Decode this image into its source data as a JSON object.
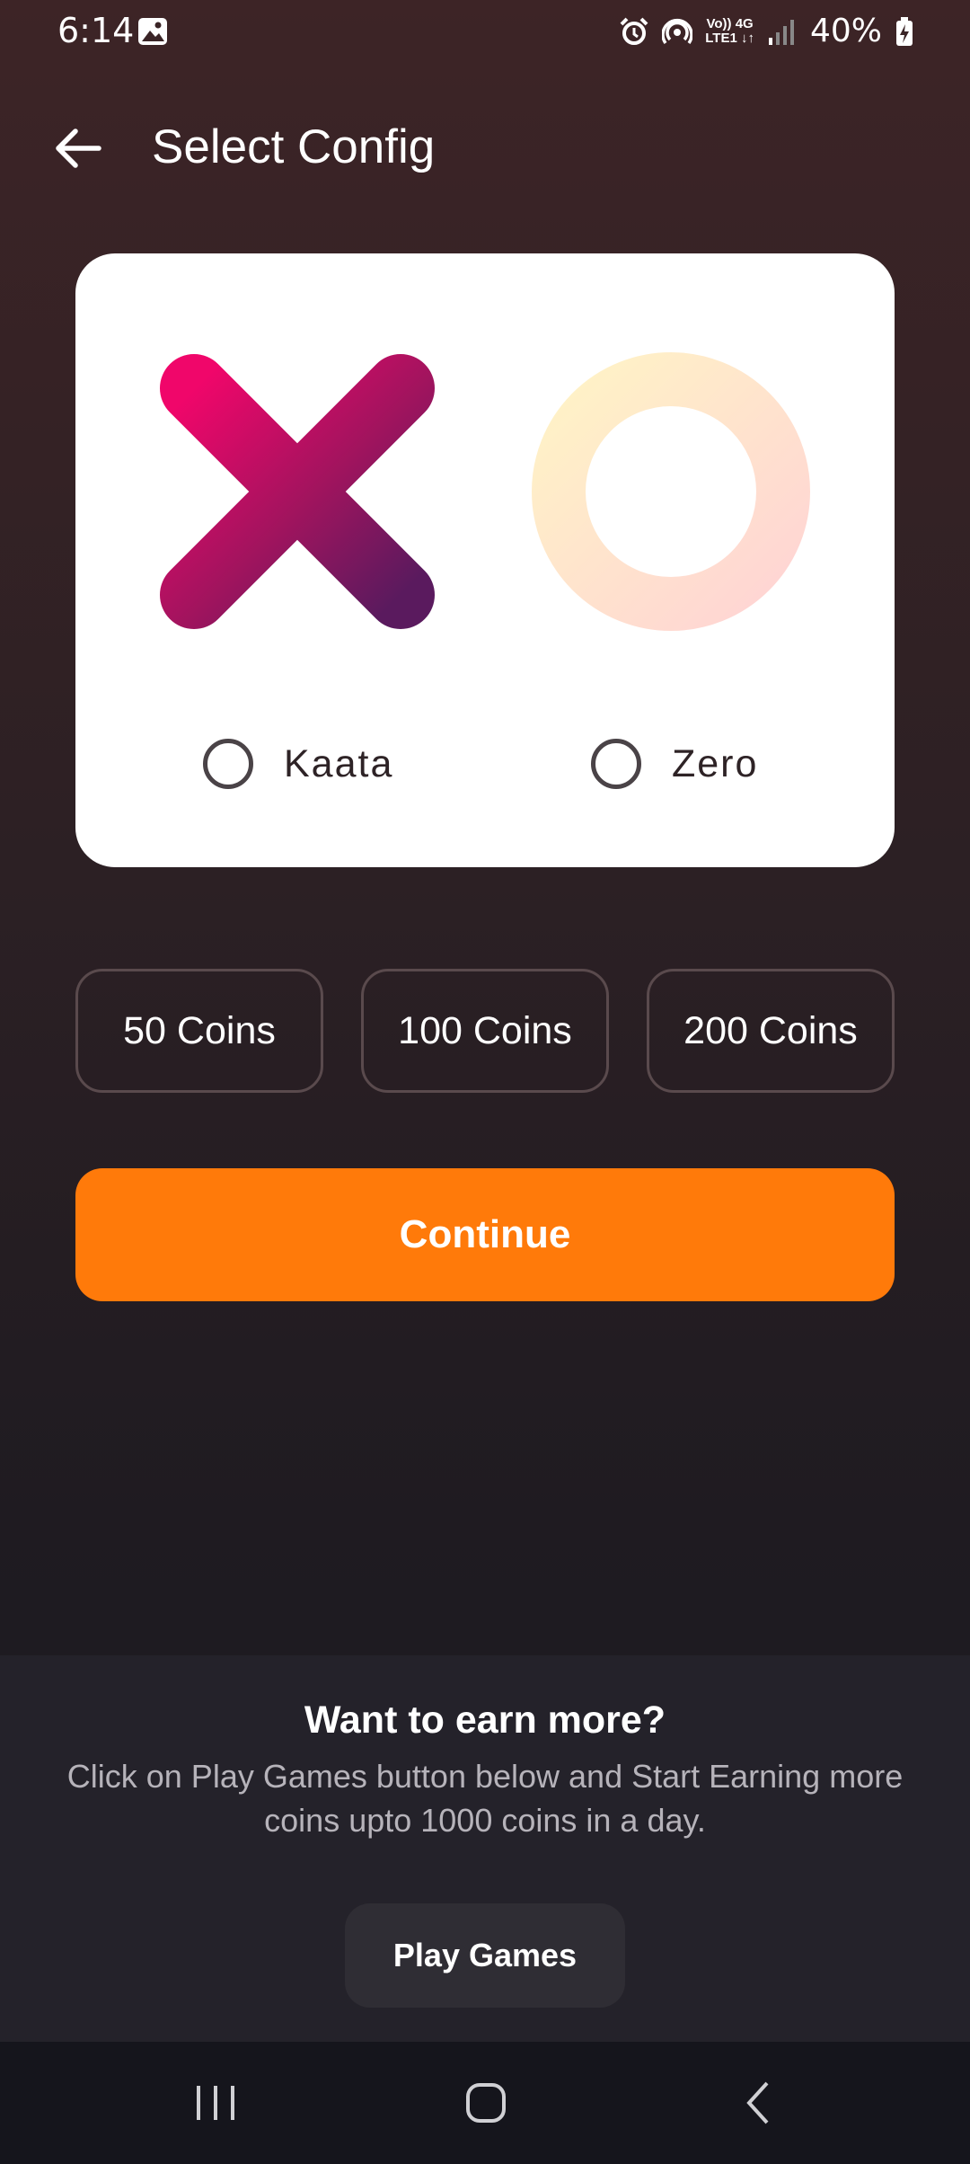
{
  "status_bar": {
    "time": "6:14",
    "network_top": "Vo)) 4G",
    "network_bottom": "LTE1 ↓↑",
    "battery": "40%"
  },
  "header": {
    "title": "Select Config"
  },
  "card": {
    "options": [
      {
        "label": "Kaata",
        "icon": "x-mark-icon",
        "selected": false
      },
      {
        "label": "Zero",
        "icon": "o-mark-icon",
        "selected": false
      }
    ]
  },
  "coins": [
    {
      "label": "50 Coins"
    },
    {
      "label": "100 Coins"
    },
    {
      "label": "200 Coins"
    }
  ],
  "continue_label": "Continue",
  "promo": {
    "title": "Want to earn more?",
    "text": "Click on Play Games button below and Start Earning more coins upto 1000 coins in a day.",
    "button_label": "Play Games"
  },
  "colors": {
    "accent": "#ff7a0a",
    "x_start": "#f0066a",
    "x_end": "#5a1a5e",
    "o_start": "#fff0c8",
    "o_end": "#ffd8d6"
  }
}
